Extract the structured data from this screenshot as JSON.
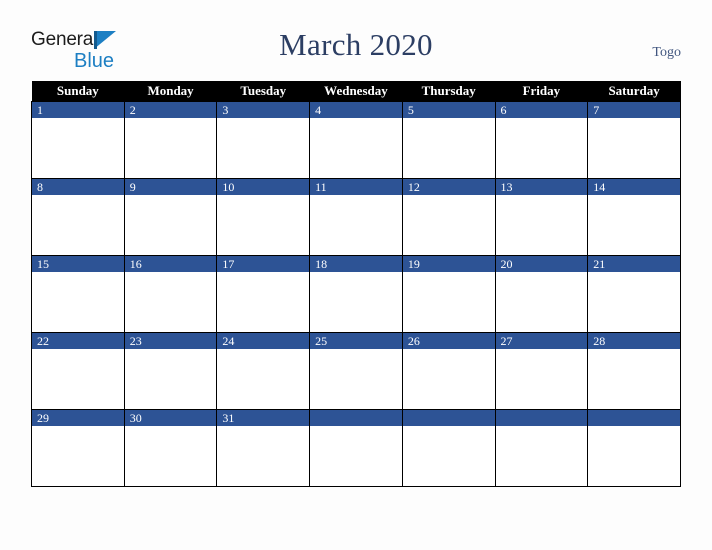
{
  "brand": {
    "name_part1": "General",
    "name_part2": "Blue",
    "triangle_color": "#1d7fc3",
    "text_color": "#1c1c1c"
  },
  "header": {
    "title": "March 2020",
    "country": "Togo",
    "title_color": "#2c3e63",
    "country_color": "#41567f"
  },
  "calendar": {
    "month": "March",
    "year": "2020",
    "header_bg": "#000000",
    "header_text": "#ffffff",
    "daybar_bg": "#2d5395",
    "daybar_text": "#ffffff",
    "cell_bg": "#ffffff",
    "border_color": "#000000",
    "weekdays": [
      "Sunday",
      "Monday",
      "Tuesday",
      "Wednesday",
      "Thursday",
      "Friday",
      "Saturday"
    ],
    "weeks": [
      [
        "1",
        "2",
        "3",
        "4",
        "5",
        "6",
        "7"
      ],
      [
        "8",
        "9",
        "10",
        "11",
        "12",
        "13",
        "14"
      ],
      [
        "15",
        "16",
        "17",
        "18",
        "19",
        "20",
        "21"
      ],
      [
        "22",
        "23",
        "24",
        "25",
        "26",
        "27",
        "28"
      ],
      [
        "29",
        "30",
        "31",
        "",
        "",
        "",
        ""
      ]
    ]
  },
  "page": {
    "background": "#fdfdfd"
  }
}
